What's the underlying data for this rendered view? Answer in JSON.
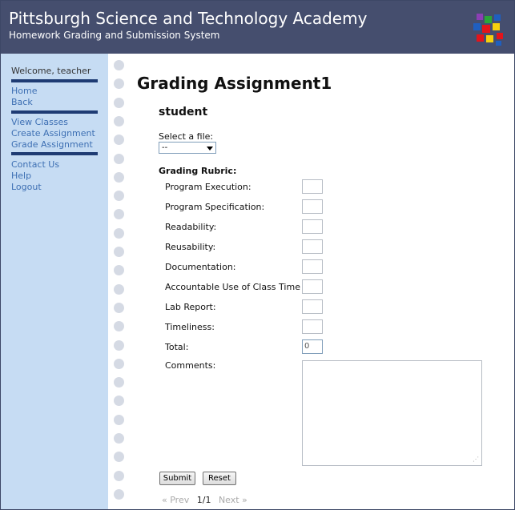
{
  "header": {
    "title": "Pittsburgh Science and Technology Academy",
    "subtitle": "Homework Grading and Submission System",
    "logo_colors": [
      "#e3141b",
      "#1f5fbf",
      "#2aa639",
      "#f6d10e",
      "#8c3fb5"
    ]
  },
  "sidebar": {
    "welcome": "Welcome, teacher",
    "nav_primary": [
      {
        "label": "Home"
      },
      {
        "label": "Back"
      }
    ],
    "nav_secondary": [
      {
        "label": "View Classes"
      },
      {
        "label": "Create Assignment"
      },
      {
        "label": "Grade Assignment"
      }
    ],
    "nav_footer": [
      {
        "label": "Contact Us"
      },
      {
        "label": "Help"
      },
      {
        "label": "Logout"
      }
    ]
  },
  "main": {
    "title": "Grading Assignment1",
    "student": "student",
    "file_label": "Select a file:",
    "file_selected": "--",
    "rubric_label": "Grading Rubric:",
    "criteria": [
      {
        "label": "Program Execution:",
        "value": ""
      },
      {
        "label": "Program Specification:",
        "value": ""
      },
      {
        "label": "Readability:",
        "value": ""
      },
      {
        "label": "Reusability:",
        "value": ""
      },
      {
        "label": "Documentation:",
        "value": ""
      },
      {
        "label": "Accountable Use of Class Time",
        "value": ""
      },
      {
        "label": "Lab Report:",
        "value": ""
      },
      {
        "label": "Timeliness:",
        "value": ""
      }
    ],
    "total_label": "Total:",
    "total_value": "0",
    "comments_label": "Comments:",
    "comments_value": "",
    "submit_label": "Submit",
    "reset_label": "Reset",
    "pager": {
      "prev": "« Prev",
      "current": "1/1",
      "next": "Next »"
    }
  }
}
